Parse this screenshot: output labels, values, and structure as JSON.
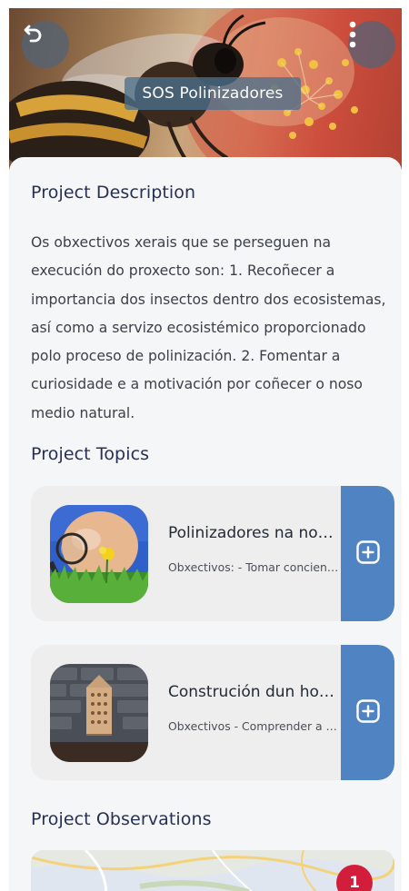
{
  "header": {
    "title": "SOS Polinizadores",
    "back_icon": "back-arrow-icon",
    "menu_icon": "vertical-dots-icon"
  },
  "description": {
    "heading": "Project Description",
    "text": "Os obxectivos xerais que se perseguen na execución do proxecto son: 1. Recoñecer a importancia dos insectos dentro dos ecosistemas, así como a servizo ecosistémico proporcionado polo proceso de polinización. 2. Fomentar a curiosidade e a motivación por coñecer o noso medio natural."
  },
  "topics": {
    "heading": "Project Topics",
    "items": [
      {
        "title": "Polinizadores na nossa contorna",
        "subtitle": "Obxectivos: - Tomar conciencia da importancia",
        "add_icon": "plus-square-icon"
      },
      {
        "title": "Construción dun hotel de insectos",
        "subtitle": "Obxectivos - Comprender a importancia",
        "add_icon": "plus-square-icon"
      }
    ]
  },
  "observations": {
    "heading": "Project Observations",
    "badge_count": "1"
  },
  "colors": {
    "accent": "#4f83c2",
    "heading": "#263052",
    "badge": "#d21e3a",
    "card": "#eeeeee"
  }
}
